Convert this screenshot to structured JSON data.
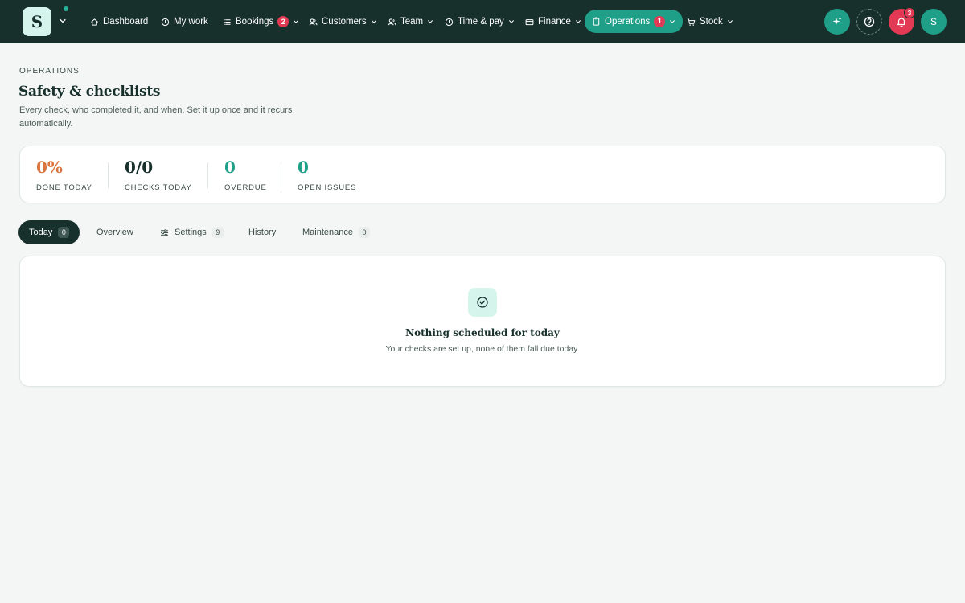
{
  "app": {
    "logo_letter": "S",
    "colors": {
      "nav_bg": "#17302b",
      "accent": "#1f9e88",
      "alert": "#e23a55",
      "warn": "#d9753f",
      "mint": "#d5f5ec"
    }
  },
  "nav": {
    "items": [
      {
        "label": "Dashboard",
        "icon": "home-icon"
      },
      {
        "label": "My work",
        "icon": "clock-icon"
      },
      {
        "label": "Bookings",
        "icon": "list-icon",
        "badge": "2",
        "has_menu": true
      },
      {
        "label": "Customers",
        "icon": "users-icon",
        "has_menu": true
      },
      {
        "label": "Team",
        "icon": "team-icon",
        "has_menu": true
      },
      {
        "label": "Time & pay",
        "icon": "clock-icon",
        "has_menu": true
      },
      {
        "label": "Finance",
        "icon": "card-icon",
        "has_menu": true
      },
      {
        "label": "Operations",
        "icon": "clipboard-icon",
        "badge": "1",
        "has_menu": true,
        "active": true
      },
      {
        "label": "Stock",
        "icon": "cart-icon",
        "has_menu": true
      }
    ],
    "notifications_count": "3",
    "avatar_initial": "S"
  },
  "header": {
    "eyebrow": "OPERATIONS",
    "title": "Safety & checklists",
    "subtitle": "Every check, who completed it, and when. Set it up once and it recurs automatically."
  },
  "stats": [
    {
      "value": "0%",
      "label": "DONE TODAY",
      "color": "#d9753f"
    },
    {
      "value": "0/0",
      "label": "CHECKS TODAY",
      "color": "#17302b"
    },
    {
      "value": "0",
      "label": "OVERDUE",
      "color": "#1f9e88"
    },
    {
      "value": "0",
      "label": "OPEN ISSUES",
      "color": "#1f9e88"
    }
  ],
  "tabs": [
    {
      "label": "Today",
      "count": "0",
      "active": true
    },
    {
      "label": "Overview"
    },
    {
      "label": "Settings",
      "count": "9",
      "icon": "sliders-icon"
    },
    {
      "label": "History"
    },
    {
      "label": "Maintenance",
      "count": "0"
    }
  ],
  "empty_state": {
    "icon": "check-circle-icon",
    "title": "Nothing scheduled for today",
    "message": "Your checks are set up, none of them fall due today."
  }
}
